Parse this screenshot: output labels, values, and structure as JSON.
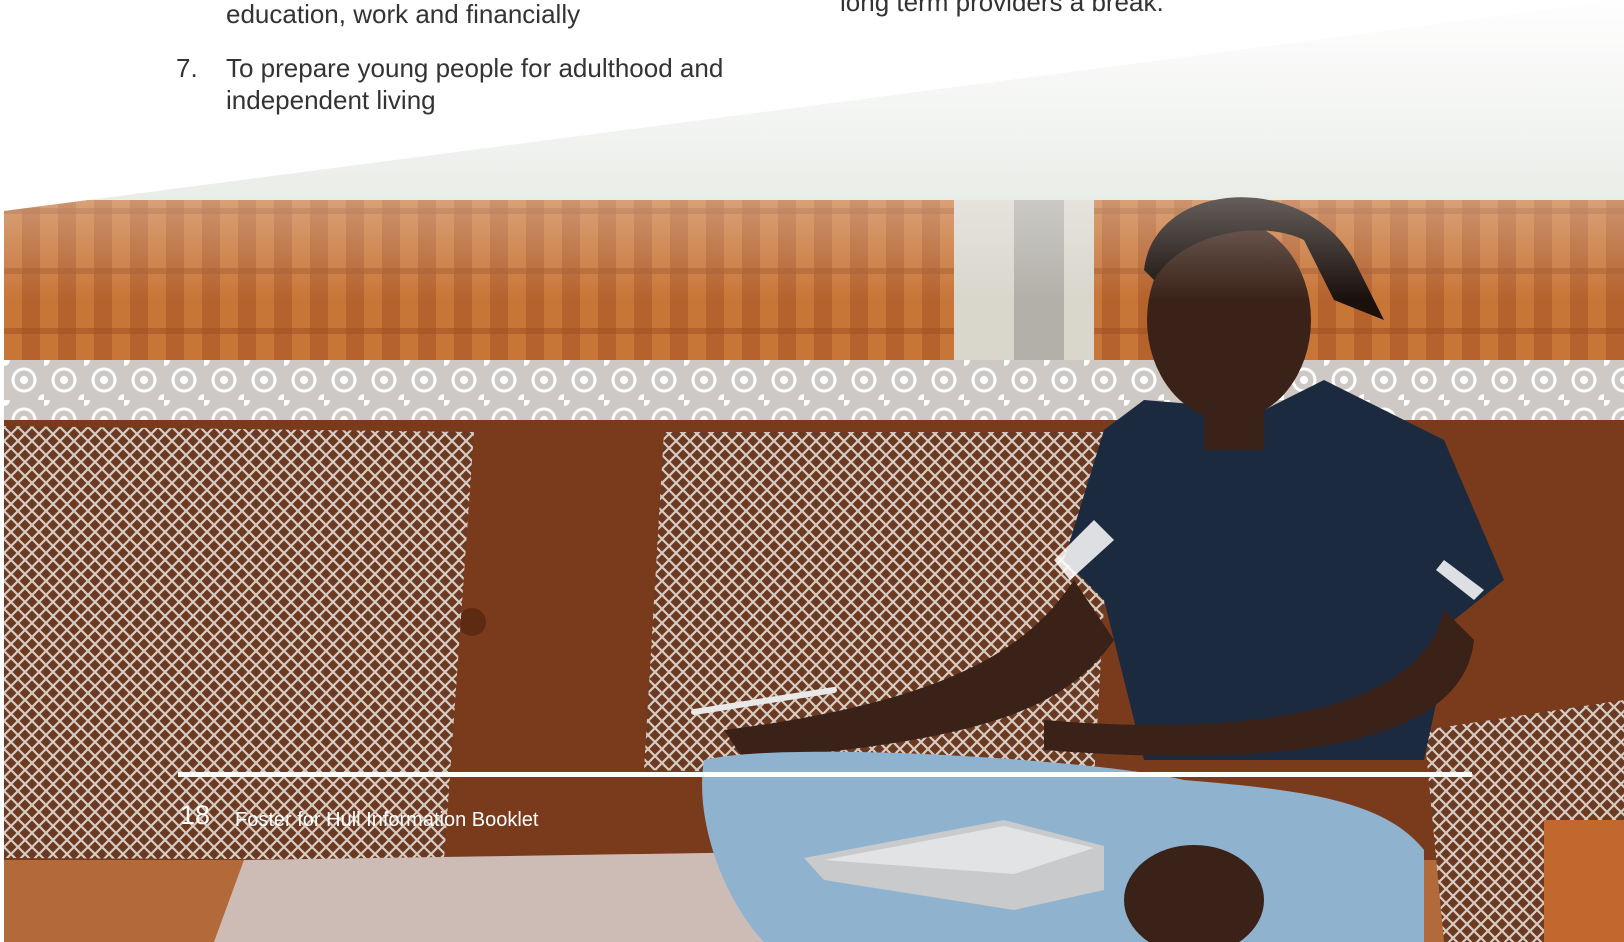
{
  "document": {
    "list_continuation": "education, work and financially",
    "list_item": {
      "number": "7.",
      "text": "To prepare young people for adulthood and independent living"
    },
    "right_continuation": "long term providers a break."
  },
  "footer": {
    "page_number": "18",
    "title": "Foster for Hull Information Booklet"
  },
  "photo": {
    "subject": "young-person-on-sofa-with-laptop",
    "colors": {
      "curtain": "#b8642e",
      "sofa": "#7a3a1c",
      "shirt": "#1c2a40",
      "jeans": "#8fb2cf",
      "lace": "#e8e4e0",
      "skin": "#3a2218"
    }
  }
}
